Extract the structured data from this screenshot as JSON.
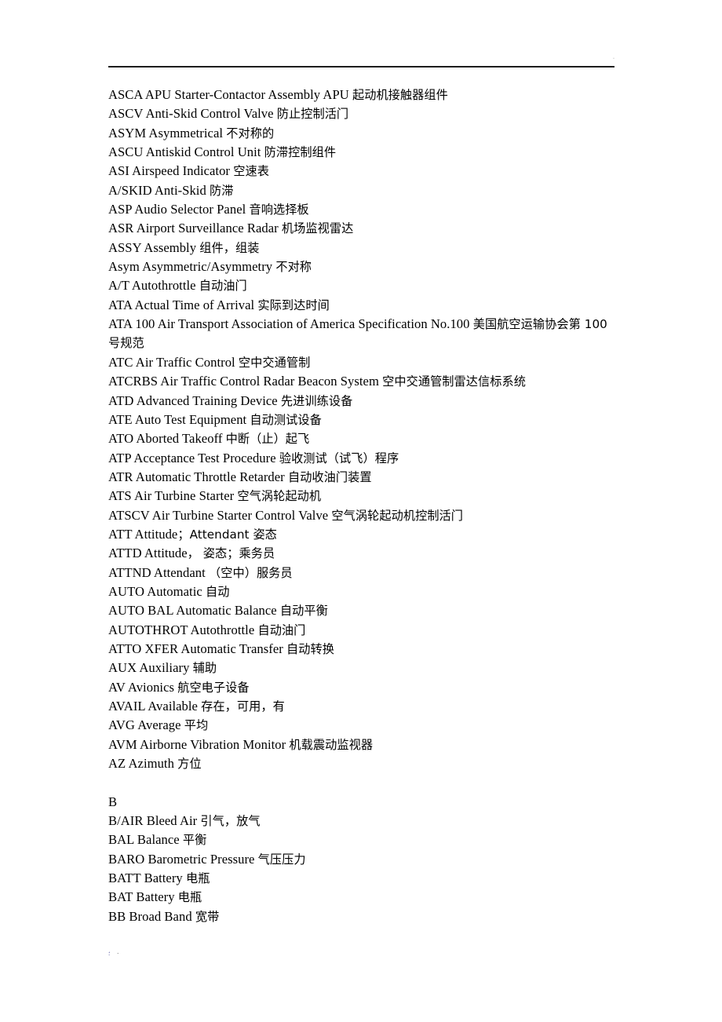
{
  "document": {
    "header": {
      "corner_mark": "·"
    },
    "footer": {
      "mark_left": "؛",
      "mark_right": "·"
    },
    "entries": [
      {
        "en": "ASCA APU Starter-Contactor Assembly APU ",
        "zh": "起动机接触器组件"
      },
      {
        "en": "ASCV Anti-Skid Control Valve ",
        "zh": " 防止控制活门"
      },
      {
        "en": "ASYM Asymmetrical ",
        "zh": " 不对称的"
      },
      {
        "en": "ASCU Antiskid Control Unit ",
        "zh": " 防滞控制组件"
      },
      {
        "en": "ASI Airspeed Indicator ",
        "zh": " 空速表"
      },
      {
        "en": "A/SKID Anti-Skid ",
        "zh": " 防滞"
      },
      {
        "en": "ASP Audio Selector Panel ",
        "zh": " 音响选择板"
      },
      {
        "en": "ASR Airport Surveillance Radar ",
        "zh": " 机场监视雷达"
      },
      {
        "en": "ASSY Assembly ",
        "zh": " 组件，组装"
      },
      {
        "en": "Asym Asymmetric/Asymmetry ",
        "zh": " 不对称"
      },
      {
        "en": "A/T Autothrottle ",
        "zh": " 自动油门"
      },
      {
        "en": "ATA Actual Time of Arrival ",
        "zh": " 实际到达时间"
      },
      {
        "en": "ATA 100 Air Transport Association of America Specification No.100 ",
        "zh": " 美国航空运输协会第 100 号规范"
      },
      {
        "en": "ATC Air Traffic Control ",
        "zh": " 空中交通管制"
      },
      {
        "en": "ATCRBS Air Traffic Control Radar Beacon System ",
        "zh": " 空中交通管制雷达信标系统"
      },
      {
        "en": "ATD Advanced Training Device ",
        "zh": " 先进训练设备"
      },
      {
        "en": "ATE Auto Test Equipment ",
        "zh": " 自动测试设备"
      },
      {
        "en": "ATO Aborted Takeoff ",
        "zh": " 中断（止）起飞"
      },
      {
        "en": "ATP Acceptance Test Procedure ",
        "zh": " 验收测试（试飞）程序"
      },
      {
        "en": "ATR Automatic Throttle Retarder ",
        "zh": " 自动收油门装置"
      },
      {
        "en": "ATS Air Turbine Starter ",
        "zh": " 空气涡轮起动机"
      },
      {
        "en": "ATSCV Air Turbine Starter Control Valve ",
        "zh": " 空气涡轮起动机控制活门"
      },
      {
        "en": "ATT Attitude",
        "zh": "；Attendant 姿态"
      },
      {
        "en": "ATTD Attitude",
        "zh": "， 姿态；乘务员"
      },
      {
        "en": "ATTND Attendant ",
        "zh": " （空中）服务员"
      },
      {
        "en": "AUTO Automatic ",
        "zh": " 自动"
      },
      {
        "en": "AUTO BAL Automatic Balance ",
        "zh": " 自动平衡"
      },
      {
        "en": "AUTOTHROT Autothrottle ",
        "zh": " 自动油门"
      },
      {
        "en": "ATTO XFER Automatic Transfer ",
        "zh": " 自动转换"
      },
      {
        "en": "AUX Auxiliary ",
        "zh": " 辅助"
      },
      {
        "en": "AV Avionics ",
        "zh": " 航空电子设备"
      },
      {
        "en": "AVAIL Available ",
        "zh": " 存在，可用，有"
      },
      {
        "en": "AVG Average ",
        "zh": " 平均"
      },
      {
        "en": "AVM Airborne Vibration Monitor ",
        "zh": " 机载震动监视器"
      },
      {
        "en": "AZ Azimuth ",
        "zh": " 方位"
      },
      {
        "en": "",
        "zh": ""
      },
      {
        "en": "B",
        "zh": ""
      },
      {
        "en": "B/AIR Bleed Air ",
        "zh": " 引气，放气"
      },
      {
        "en": "BAL Balance ",
        "zh": " 平衡"
      },
      {
        "en": "BARO Barometric Pressure ",
        "zh": " 气压压力"
      },
      {
        "en": "BATT Battery ",
        "zh": " 电瓶"
      },
      {
        "en": "BAT Battery ",
        "zh": " 电瓶"
      },
      {
        "en": "BB Broad Band ",
        "zh": " 宽带"
      }
    ]
  }
}
